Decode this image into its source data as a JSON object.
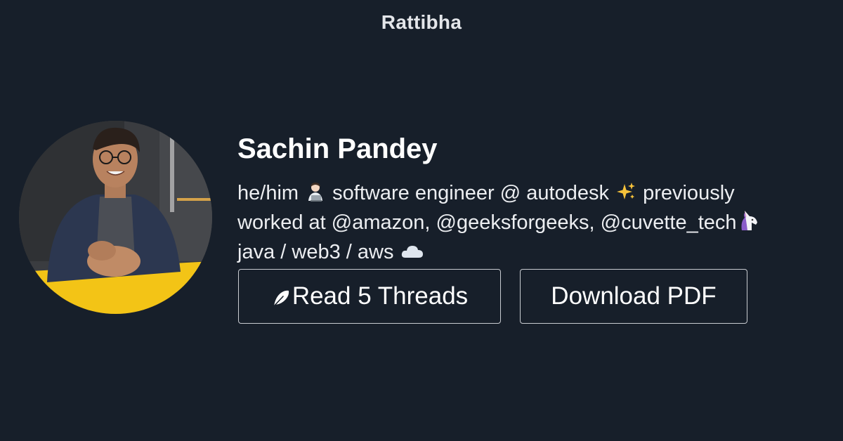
{
  "site": {
    "brand": "Rattibha"
  },
  "profile": {
    "name": "Sachin Pandey",
    "bio_lines": [
      [
        "he/him ",
        "technologist-emoji",
        " software engineer @ autodesk ",
        "sparkles-emoji",
        " previously"
      ],
      [
        "worked at @amazon, @geeksforgeeks, @cuvette_tech",
        "unicorn-emoji"
      ],
      [
        "java / web3 / aws ",
        "cloud-emoji"
      ]
    ],
    "bio_text": {
      "line1_a": "he/him",
      "line1_b": "software engineer @ autodesk",
      "line1_c": "previously",
      "line2": "worked at @amazon, @geeksforgeeks, @cuvette_tech",
      "line3": "java / web3 / aws"
    },
    "avatar_icon": "profile-photo"
  },
  "actions": {
    "read_threads_label": "Read 5 Threads",
    "read_threads_icon": "feather-icon",
    "download_pdf_label": "Download PDF"
  },
  "colors": {
    "background": "#171f2a",
    "text": "#ffffff",
    "button_border": "#c9ccd1"
  }
}
